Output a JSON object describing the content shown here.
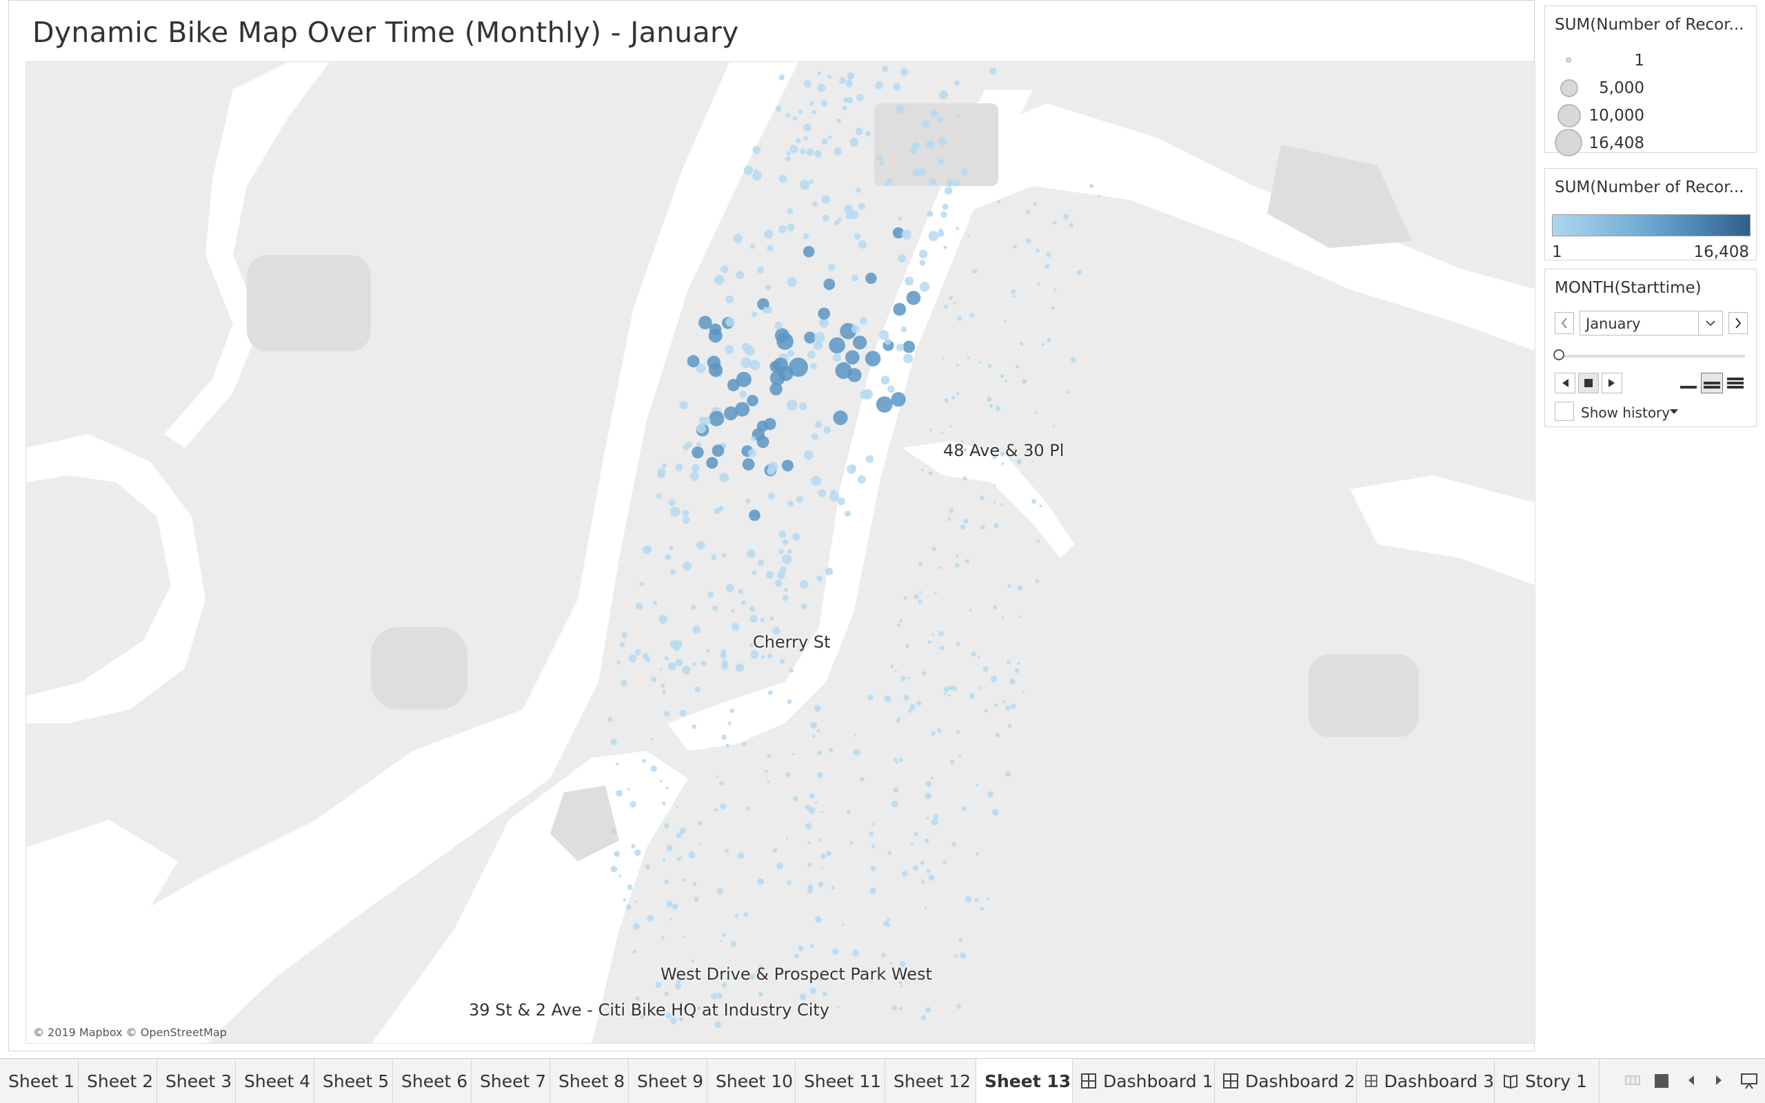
{
  "sheet": {
    "title": "Dynamic Bike Map Over Time (Monthly) - January",
    "attribution": "© 2019 Mapbox © OpenStreetMap",
    "map_labels": [
      "48 Ave & 30 Pl",
      "Cherry St",
      "West Drive & Prospect Park West",
      "39 St & 2 Ave - Citi Bike HQ at Industry City"
    ]
  },
  "legend_size": {
    "title": "SUM(Number of Recor...",
    "items": [
      "1",
      "5,000",
      "10,000",
      "16,408"
    ]
  },
  "legend_color": {
    "title": "SUM(Number of Recor...",
    "min": "1",
    "max": "16,408",
    "ramp_colors": [
      "#aed7f0",
      "#2f5f8a"
    ]
  },
  "page_filter": {
    "title": "MONTH(Starttime)",
    "selected": "January",
    "show_history": "Show history",
    "slider_value": 0
  },
  "tabs": [
    {
      "label": "Sheet 1",
      "kind": "sheet"
    },
    {
      "label": "Sheet 2",
      "kind": "sheet"
    },
    {
      "label": "Sheet 3",
      "kind": "sheet"
    },
    {
      "label": "Sheet 4",
      "kind": "sheet"
    },
    {
      "label": "Sheet 5",
      "kind": "sheet"
    },
    {
      "label": "Sheet 6",
      "kind": "sheet"
    },
    {
      "label": "Sheet 7",
      "kind": "sheet"
    },
    {
      "label": "Sheet 8",
      "kind": "sheet"
    },
    {
      "label": "Sheet 9",
      "kind": "sheet"
    },
    {
      "label": "Sheet 10",
      "kind": "sheet"
    },
    {
      "label": "Sheet 11",
      "kind": "sheet"
    },
    {
      "label": "Sheet 12",
      "kind": "sheet"
    },
    {
      "label": "Sheet 13",
      "kind": "sheet",
      "active": true
    },
    {
      "label": "Dashboard 1",
      "kind": "dashboard"
    },
    {
      "label": "Dashboard 2",
      "kind": "dashboard"
    },
    {
      "label": "Dashboard 3",
      "kind": "dashboard"
    },
    {
      "label": "Story 1",
      "kind": "story"
    }
  ],
  "colors": {
    "land": "#ececec",
    "water": "#ffffff",
    "marker_light": "#b4d9f2",
    "marker_dark": "#5b95c4"
  }
}
